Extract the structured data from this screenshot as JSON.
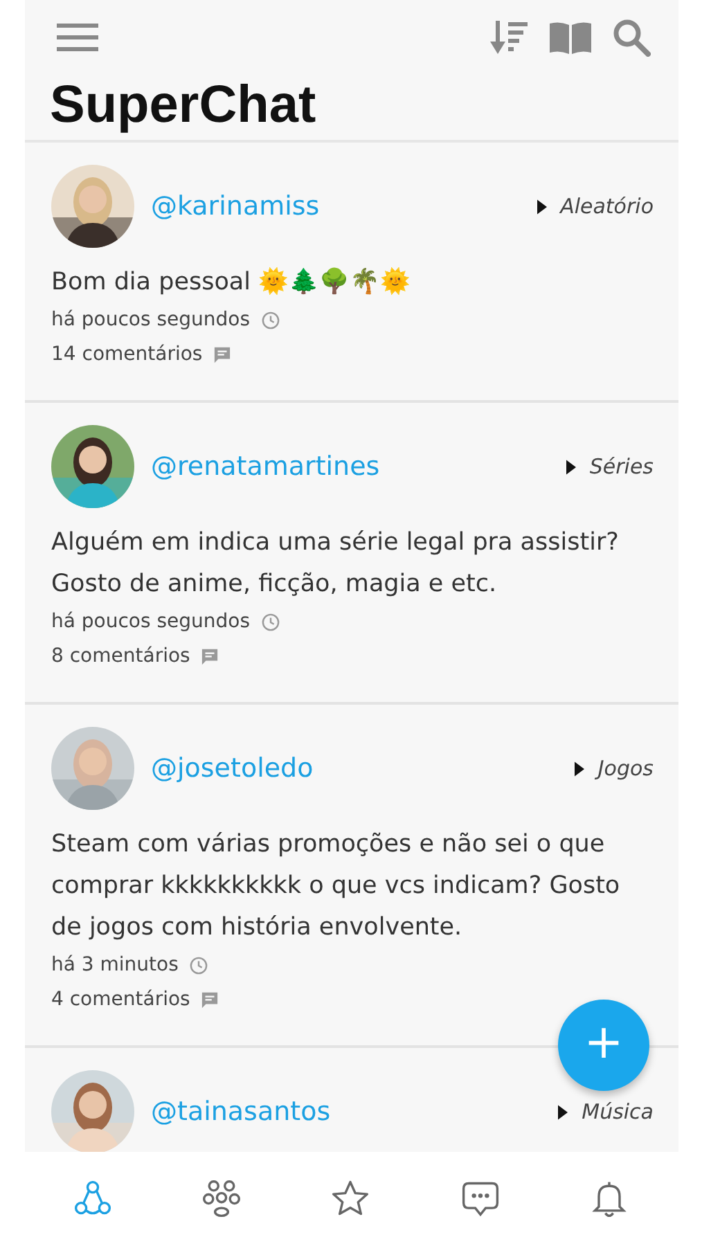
{
  "app": {
    "title": "SuperChat"
  },
  "posts": [
    {
      "username": "@karinamiss",
      "category": "Aleatório",
      "text": "Bom dia pessoal 🌞🌲🌳🌴🌞",
      "time": "há poucos segundos",
      "comments": "14 comentários"
    },
    {
      "username": "@renatamartines",
      "category": "Séries",
      "text": "Alguém em indica uma série legal pra assistir? Gosto de anime, ficção, magia e etc.",
      "time": "há poucos segundos",
      "comments": "8 comentários"
    },
    {
      "username": "@josetoledo",
      "category": "Jogos",
      "text": "Steam com várias promoções e não sei o que comprar kkkkkkkkkk o que vcs indicam? Gosto de jogos com história envolvente.",
      "time": "há 3 minutos",
      "comments": "4 comentários"
    },
    {
      "username": "@tainasantos",
      "category": "Música"
    }
  ],
  "fab": {
    "label": "+"
  },
  "nav": [
    {
      "kind": "feed",
      "selected": true
    },
    {
      "kind": "groups",
      "selected": false
    },
    {
      "kind": "favorites",
      "selected": false
    },
    {
      "kind": "chats",
      "selected": false
    },
    {
      "kind": "notifications",
      "selected": false
    }
  ]
}
